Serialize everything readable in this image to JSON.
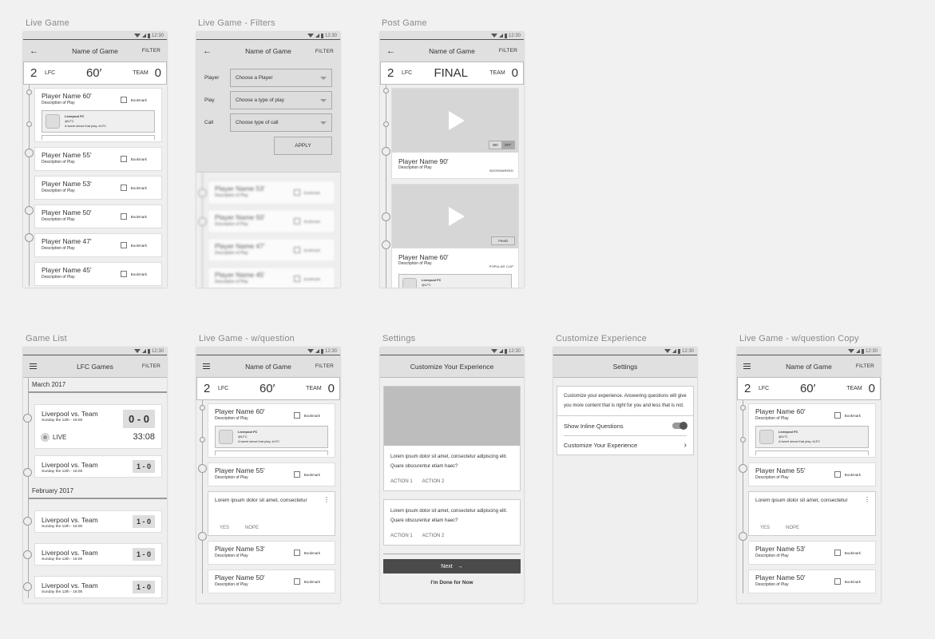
{
  "status_bar": {
    "time": "12:30"
  },
  "live_game": {
    "artboard_title": "Live Game",
    "appbar": {
      "title": "Name of Game",
      "action": "FILTER",
      "nav": "back-arrow"
    },
    "score": {
      "home_score": "2",
      "home": "LFC",
      "status": "60′",
      "away": "TEAM",
      "away_score": "0"
    },
    "featured": {
      "player": "Player Name 60'",
      "desc": "Description of Play",
      "bookmark": "Bookmark",
      "tweet": {
        "name": "Liverpool FC",
        "handle": "@LFC",
        "text": "A tweet about that play. #LFC"
      }
    },
    "plays": [
      {
        "player": "Player Name 55'",
        "desc": "Description of Play",
        "bookmark": "Bookmark"
      },
      {
        "player": "Player Name 53'",
        "desc": "Description of Play",
        "bookmark": "Bookmark"
      },
      {
        "player": "Player Name 50'",
        "desc": "Description of Play",
        "bookmark": "Bookmark"
      },
      {
        "player": "Player Name 47'",
        "desc": "Description of Play",
        "bookmark": "Bookmark"
      },
      {
        "player": "Player Name 45'",
        "desc": "Description of Play",
        "bookmark": "Bookmark"
      }
    ]
  },
  "filters": {
    "artboard_title": "Live Game - Filters",
    "appbar": {
      "title": "Name of Game",
      "action": "FILTER"
    },
    "fields": [
      {
        "label": "Player",
        "value": "Choose a Player"
      },
      {
        "label": "Play",
        "value": "Choose a type of play"
      },
      {
        "label": "Call",
        "value": "Choose type of call"
      }
    ],
    "apply": "APPLY",
    "plays": [
      {
        "player": "Player Name 53'",
        "desc": "Description of Play",
        "bookmark": "Bookmark"
      },
      {
        "player": "Player Name 50'",
        "desc": "Description of Play",
        "bookmark": "Bookmark"
      },
      {
        "player": "Player Name 47'",
        "desc": "Description of Play",
        "bookmark": "Bookmark"
      },
      {
        "player": "Player Name 45'",
        "desc": "Description of Play",
        "bookmark": "Bookmark"
      }
    ]
  },
  "post_game": {
    "artboard_title": "Post Game",
    "appbar": {
      "title": "Name of Game",
      "action": "FILTER"
    },
    "score": {
      "home_score": "2",
      "home": "LFC",
      "status": "FINAL",
      "away": "TEAM",
      "away_score": "0"
    },
    "videos": [
      {
        "player": "Player Name 90'",
        "desc": "Description of Play",
        "tag": "BOOKMARKED",
        "badge": [
          "360",
          "OFF"
        ]
      },
      {
        "player": "Player Name 60'",
        "desc": "Description of Play",
        "tag": "POPULAR CLIP",
        "badge": [
          "FreeD"
        ],
        "tweet": {
          "name": "Liverpool FC",
          "handle": "@LFC"
        }
      }
    ]
  },
  "game_list": {
    "artboard_title": "Game List",
    "appbar": {
      "title": "LFC Games",
      "action": "FILTER"
    },
    "months": [
      {
        "label": "March 2017",
        "games": [
          {
            "name": "Liverpool vs. Team",
            "date": "Sunday the 12th - 16:00",
            "score": "0 - 0",
            "live": "LIVE",
            "clock": "33:08"
          },
          {
            "name": "Liverpool vs. Team",
            "date": "Sunday the 12th - 16:00",
            "score": "1 - 0"
          }
        ]
      },
      {
        "label": "February 2017",
        "games": [
          {
            "name": "Liverpool vs. Team",
            "date": "Sunday the 12th - 16:00",
            "score": "1 - 0"
          },
          {
            "name": "Liverpool vs. Team",
            "date": "Sunday the 12th - 16:00",
            "score": "1 - 0"
          },
          {
            "name": "Liverpool vs. Team",
            "date": "Sunday the 12th - 16:00",
            "score": "1 - 0"
          }
        ]
      }
    ]
  },
  "question": {
    "artboard_title": "Live Game - w/question",
    "appbar": {
      "title": "Name of Game",
      "action": "FILTER"
    },
    "score": {
      "home_score": "2",
      "home": "LFC",
      "status": "60′",
      "away": "TEAM",
      "away_score": "0"
    },
    "featured": {
      "player": "Player Name 60'",
      "desc": "Description of Play",
      "bookmark": "Bookmark",
      "tweet": {
        "name": "Liverpool FC",
        "handle": "@LFC",
        "text": "A tweet about that play. #LFC"
      }
    },
    "play_55": {
      "player": "Player Name 55'",
      "desc": "Description of Play",
      "bookmark": "Bookmark"
    },
    "prompt": {
      "text": "Lorem ipsum dolor sit amet, consectetur",
      "yes": "YES",
      "no": "NOPE"
    },
    "plays": [
      {
        "player": "Player Name 53'",
        "desc": "Description of Play",
        "bookmark": "Bookmark"
      },
      {
        "player": "Player Name 50'",
        "desc": "Description of Play",
        "bookmark": "Bookmark"
      }
    ]
  },
  "question_copy": {
    "artboard_title": "Live Game - w/question Copy"
  },
  "settings": {
    "artboard_title": "Settings",
    "appbar": {
      "title": "Customize Your Experience"
    },
    "cards": [
      {
        "text": "Lorem ipsum dolor sit amet, consectetur adipiscing elit. Quare obscurentur etiam haec?",
        "a1": "ACTION 1",
        "a2": "ACTION 2"
      },
      {
        "text": "Lorem ipsum dolor sit amet, consectetur adipiscing elit. Quare obscurentur etiam haec?",
        "a1": "ACTION 1",
        "a2": "ACTION 2"
      }
    ],
    "next": "Next",
    "done": "I'm Done for Now"
  },
  "customize": {
    "artboard_title": "Customize Experience",
    "appbar": {
      "title": "Settings"
    },
    "desc": "Customize your experience. Answering questions will give you more content that is right for you and less that is not.",
    "toggle_label": "Show Inline Questions",
    "toggle_on": true,
    "link_label": "Customize Your Experience"
  }
}
